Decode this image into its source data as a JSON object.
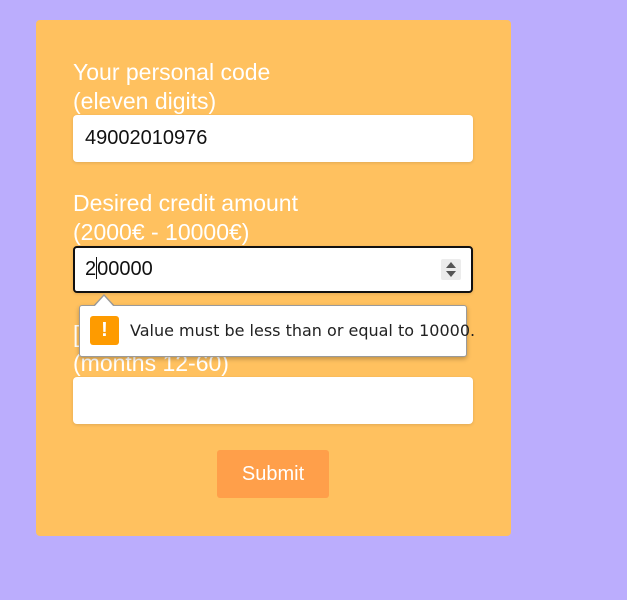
{
  "form": {
    "personal_code": {
      "label_line1": "Your personal code",
      "label_line2": "(eleven digits)",
      "value": "49002010976"
    },
    "credit_amount": {
      "label_line1": "Desired credit amount",
      "label_line2": "(2000€ - 10000€)",
      "value_before_caret": "2",
      "value_after_caret": "00000"
    },
    "period": {
      "label_line1_visible": "[",
      "label_line2": "(months 12-60)",
      "value": ""
    },
    "submit_label": "Submit"
  },
  "validation_tooltip": {
    "icon": "!",
    "message": "Value must be less than or equal to 10000."
  },
  "colors": {
    "background": "#bbadfd",
    "card": "#ffc15f",
    "submit": "#ff9f4a",
    "warning": "#fe9b00"
  },
  "icons": [
    "spinner-icon",
    "warning-icon"
  ]
}
